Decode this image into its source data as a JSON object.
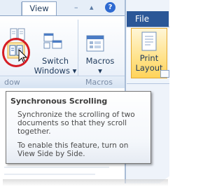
{
  "ribbon": {
    "active_tab": "View",
    "controls": {
      "minimize": "–",
      "pin": "▴",
      "help": "?"
    },
    "buttons": {
      "switch_windows": [
        "Switch",
        "Windows ▾"
      ],
      "macros": [
        "Macros",
        "▾"
      ]
    },
    "groups": {
      "window_partial": "dow",
      "macros": "Macros"
    }
  },
  "right_window": {
    "file_tab": "File",
    "print_layout": [
      "Print",
      "Layout"
    ]
  },
  "tooltip": {
    "title": "Synchronous Scrolling",
    "description": [
      "Synchronize the scrolling of two",
      "documents so that they scroll",
      "together."
    ],
    "note": [
      "To enable this feature, turn on",
      "View Side by Side."
    ]
  },
  "colors": {
    "highlight_circle": "#d51c24",
    "file_tab": "#2b5797",
    "help": "#2e6ad1"
  },
  "icons": [
    "view-side-by-side-icon",
    "synchronous-scrolling-icon",
    "mouse-pointer-icon",
    "switch-windows-icon",
    "macros-icon",
    "print-layout-icon",
    "help-icon"
  ]
}
